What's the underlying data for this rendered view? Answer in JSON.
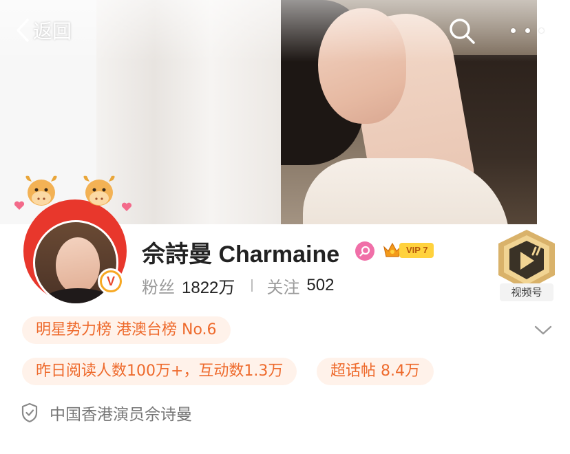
{
  "nav": {
    "back_label": "返回"
  },
  "profile": {
    "name": "佘詩曼 Charmaine",
    "gender": "female",
    "vip_label": "VIP 7",
    "verified_badge": "V",
    "followers_label": "粉丝",
    "followers_value": "1822万",
    "following_label": "关注",
    "following_value": "502",
    "video_channel_label": "视频号"
  },
  "tags": {
    "rank": "明星势力榜 港澳台榜 No.6",
    "reads": "昨日阅读人数100万+，互动数1.3万",
    "topic": "超话帖 8.4万"
  },
  "verification": {
    "text": "中国香港演员佘诗曼"
  },
  "icons": [
    "chevron-left-icon",
    "search-icon",
    "more-icon",
    "female-icon",
    "crown-icon",
    "video-channel-icon",
    "chevron-down-icon",
    "shield-check-icon",
    "ox-icon",
    "heart-icon"
  ],
  "colors": {
    "accent_orange": "#ee6a2c",
    "pill_background": "#fff2ea",
    "verified_orange": "#f7a823",
    "vip_gold": "#ffd23d",
    "gender_pink": "#f06fa8"
  }
}
